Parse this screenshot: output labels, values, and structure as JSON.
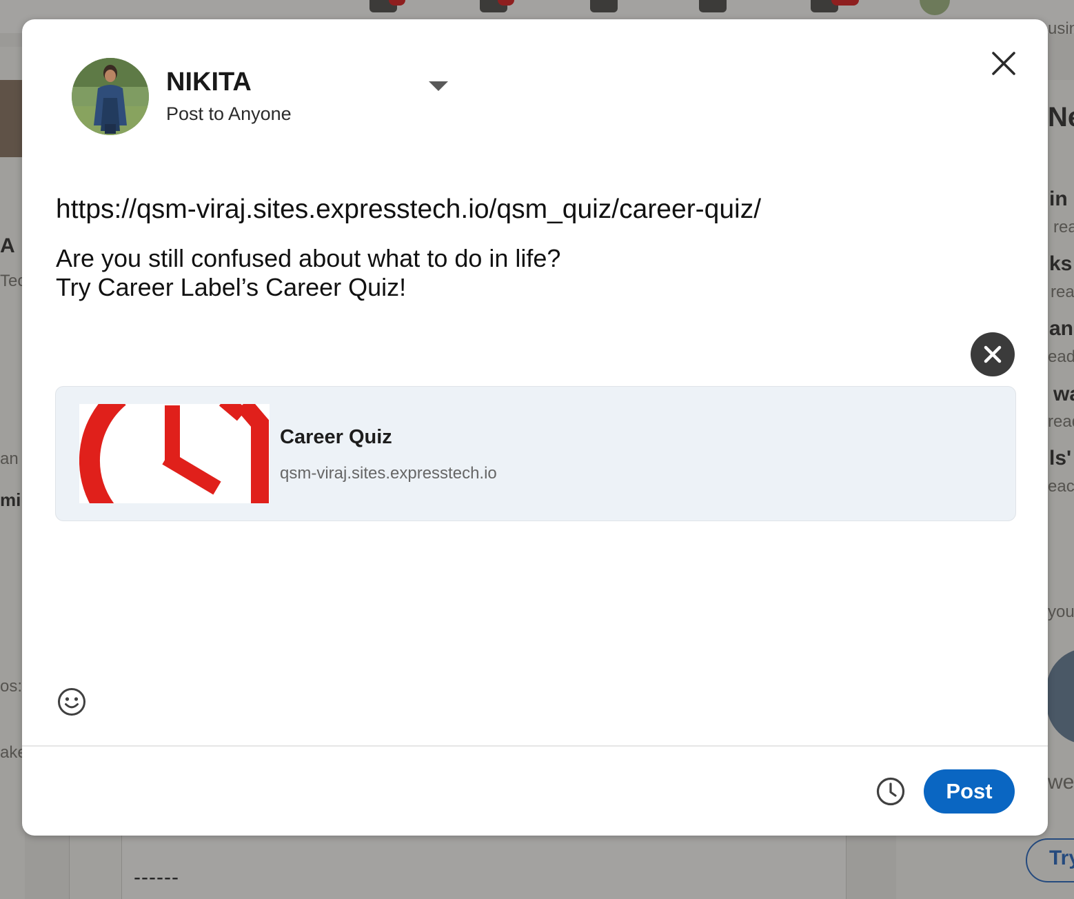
{
  "author": {
    "name": "NIKITA",
    "audience": "Post to Anyone"
  },
  "composer": {
    "url_text": "https://qsm-viraj.sites.expresstech.io/qsm_quiz/career-quiz/",
    "line1": "Are you still confused about what to do in life?",
    "line2": "Try Career Label’s Career Quiz!"
  },
  "link_preview": {
    "title": "Career Quiz",
    "domain": "qsm-viraj.sites.expresstech.io"
  },
  "footer": {
    "post_label": "Post"
  },
  "background": {
    "snippets": [
      "usin",
      "Ne",
      "in s",
      "rea",
      "ks",
      "rea",
      "and",
      "ead",
      "wa",
      "read",
      "ls'",
      "eac",
      "A",
      "Tec",
      "an A",
      "miu",
      "os:",
      "ake",
      "you",
      "we",
      "Try",
      "------"
    ]
  },
  "icons": {
    "close": "close-icon",
    "caret": "chevron-down-icon",
    "remove_preview": "close-circle-icon",
    "emoji": "smiley-icon",
    "schedule": "clock-icon"
  },
  "colors": {
    "primary": "#0a66c2",
    "preview_bg": "#edf2f7",
    "logo_red": "#e0201b"
  }
}
